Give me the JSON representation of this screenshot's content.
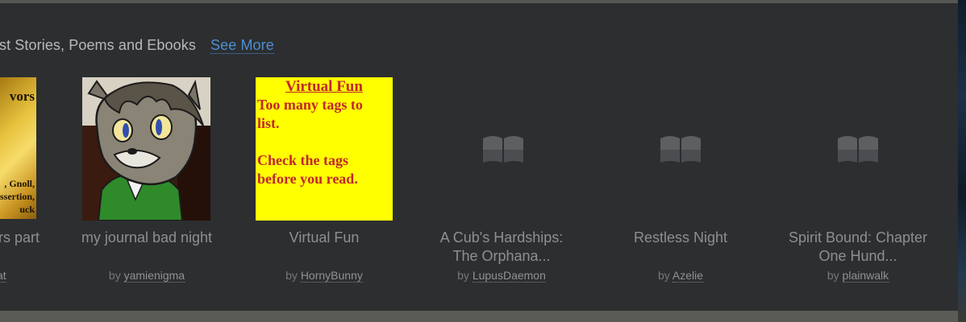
{
  "section": {
    "heading": "st Stories, Poems and Ebooks",
    "see_more": "See More"
  },
  "items": [
    {
      "title": "ors part",
      "by": "",
      "author": "at",
      "cover": {
        "kind": "gold",
        "top_text": "vors",
        "bottom_text": ", Gnoll,\nssertion,\nuck"
      }
    },
    {
      "title": "my journal bad night",
      "by": "by",
      "author": "yamienigma",
      "cover": {
        "kind": "drawing"
      }
    },
    {
      "title": "Virtual Fun",
      "by": "by",
      "author": "HornyBunny",
      "cover": {
        "kind": "yellow",
        "heading": "Virtual Fun",
        "body": "Too many tags to\nlist.\n\nCheck the tags\nbefore you read."
      }
    },
    {
      "title": "A Cub's Hardships:",
      "title_line2": "The Orphana...",
      "by": "by",
      "author": "LupusDaemon",
      "cover": {
        "kind": "placeholder",
        "icon": "book-icon"
      }
    },
    {
      "title": "Restless Night",
      "by": "by",
      "author": "Azelie",
      "cover": {
        "kind": "placeholder",
        "icon": "book-icon"
      }
    },
    {
      "title": "Spirit Bound: Chapter",
      "title_line2": "One Hund...",
      "by": "by",
      "author": "plainwalk",
      "cover": {
        "kind": "placeholder",
        "icon": "book-icon"
      }
    }
  ],
  "colors": {
    "panel": "#2c2e30",
    "link": "#4f8fd0",
    "cover_yellow": "#ffff00",
    "cover_text_red": "#c1272d"
  }
}
